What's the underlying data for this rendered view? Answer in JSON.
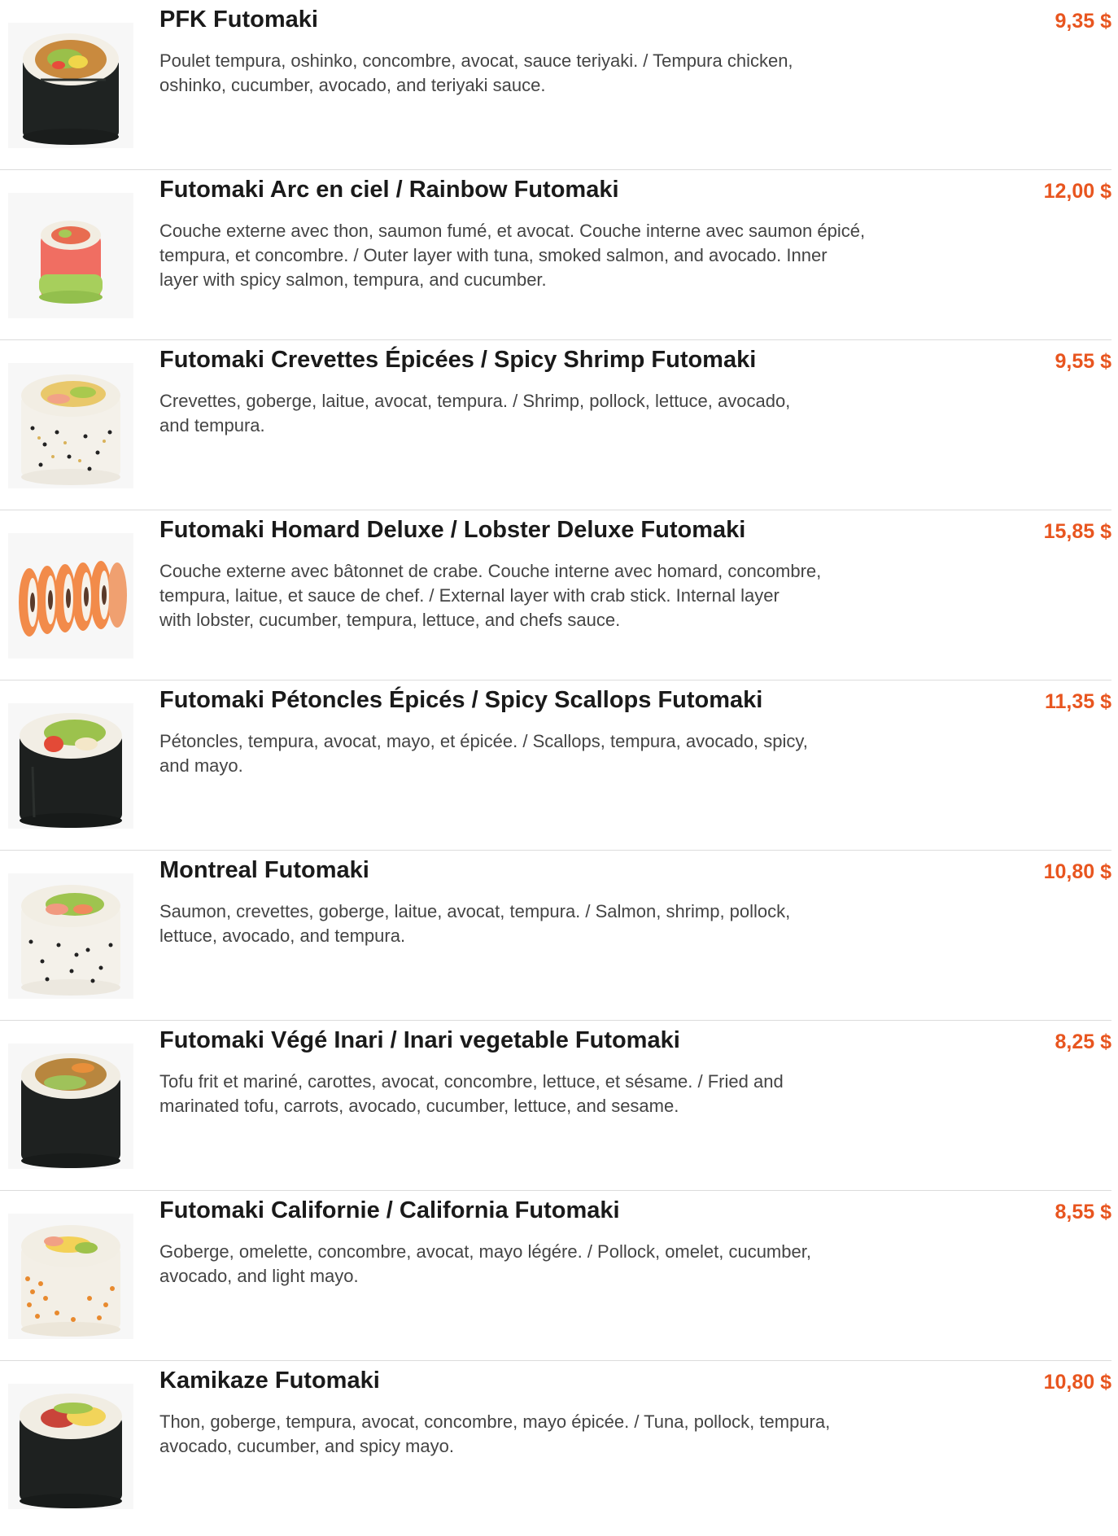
{
  "items": [
    {
      "name": "PFK Futomaki",
      "price": "9,35 $",
      "desc_lines": [
        "Poulet tempura, oshinko, concombre, avocat, sauce teriyaki. / Tempura chicken,",
        "oshinko, cucumber, avocado, and teriyaki sauce."
      ],
      "image": "pfk-futomaki-image"
    },
    {
      "name": "Futomaki Arc en ciel / Rainbow Futomaki",
      "price": "12,00 $",
      "desc_lines": [
        "Couche externe avec thon, saumon fumé, et avocat. Couche interne avec saumon épicé,",
        "tempura, et concombre. / Outer layer with tuna, smoked salmon, and avocado. Inner",
        "layer with spicy salmon, tempura, and cucumber."
      ],
      "image": "rainbow-futomaki-image"
    },
    {
      "name": "Futomaki Crevettes Épicées / Spicy Shrimp Futomaki",
      "price": "9,55 $",
      "desc_lines": [
        "Crevettes, goberge, laitue, avocat, tempura. / Shrimp, pollock, lettuce, avocado,",
        "and tempura."
      ],
      "image": "spicy-shrimp-futomaki-image"
    },
    {
      "name": "Futomaki Homard Deluxe / Lobster Deluxe Futomaki",
      "price": "15,85 $",
      "desc_lines": [
        "Couche externe avec bâtonnet de crabe. Couche interne avec homard, concombre,",
        "tempura, laitue, et sauce de chef. / External layer with crab stick. Internal layer",
        "with lobster, cucumber, tempura, lettuce, and chefs sauce."
      ],
      "image": "lobster-deluxe-futomaki-image"
    },
    {
      "name": "Futomaki Pétoncles Épicés / Spicy Scallops Futomaki",
      "price": "11,35 $",
      "desc_lines": [
        "Pétoncles, tempura, avocat, mayo, et épicée. / Scallops, tempura, avocado, spicy,",
        "and mayo."
      ],
      "image": "spicy-scallops-futomaki-image"
    },
    {
      "name": "Montreal Futomaki",
      "price": "10,80 $",
      "desc_lines": [
        "Saumon, crevettes, goberge, laitue, avocat, tempura. / Salmon, shrimp, pollock,",
        "lettuce, avocado, and tempura."
      ],
      "image": "montreal-futomaki-image"
    },
    {
      "name": "Futomaki Végé Inari / Inari vegetable Futomaki",
      "price": "8,25 $",
      "desc_lines": [
        "Tofu frit et mariné, carottes, avocat, concombre, lettuce, et sésame. / Fried and",
        "marinated tofu, carrots, avocado, cucumber, lettuce, and sesame."
      ],
      "image": "inari-vegetable-futomaki-image"
    },
    {
      "name": "Futomaki Californie / California Futomaki",
      "price": "8,55 $",
      "desc_lines": [
        "Goberge, omelette, concombre, avocat, mayo légére. / Pollock, omelet, cucumber,",
        "avocado, and light mayo."
      ],
      "image": "california-futomaki-image"
    },
    {
      "name": "Kamikaze Futomaki",
      "price": "10,80 $",
      "desc_lines": [
        "Thon, goberge, tempura, avocat, concombre, mayo épicée. / Tuna, pollock, tempura,",
        "avocado, cucumber, and spicy mayo."
      ],
      "image": "kamikaze-futomaki-image"
    }
  ]
}
